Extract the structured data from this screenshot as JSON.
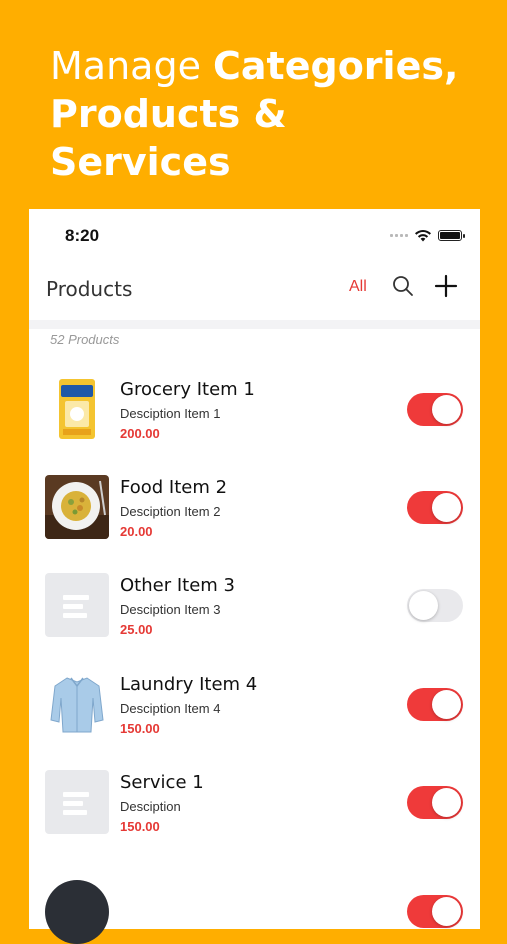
{
  "headline": {
    "light": "Manage ",
    "bold_1": "Categories,",
    "bold_2": "Products &",
    "bold_3": "Services"
  },
  "status_bar": {
    "time": "8:20",
    "icons": [
      "signal-icon",
      "wifi-icon",
      "battery-icon"
    ]
  },
  "nav": {
    "title": "Products",
    "filter_label": "All",
    "icons": [
      "search-icon",
      "plus-icon"
    ]
  },
  "list": {
    "count_label": "52 Products",
    "items": [
      {
        "name": "Grocery Item 1",
        "description": "Desciption Item 1",
        "price": "200.00",
        "enabled": true,
        "thumb": "grocery-pack-image"
      },
      {
        "name": "Food Item 2",
        "description": "Desciption Item 2",
        "price": "20.00",
        "enabled": true,
        "thumb": "food-plate-image"
      },
      {
        "name": "Other Item 3",
        "description": "Desciption Item 3",
        "price": "25.00",
        "enabled": false,
        "thumb": "placeholder-icon"
      },
      {
        "name": "Laundry Item 4",
        "description": "Desciption Item 4",
        "price": "150.00",
        "enabled": true,
        "thumb": "shirt-image"
      },
      {
        "name": "Service 1",
        "description": "Desciption",
        "price": "150.00",
        "enabled": true,
        "thumb": "placeholder-icon"
      }
    ]
  },
  "colors": {
    "background": "#FFAE00",
    "accent": "#ef3a3a",
    "price": "#e53935",
    "toggle_off": "#e9e9ec"
  }
}
